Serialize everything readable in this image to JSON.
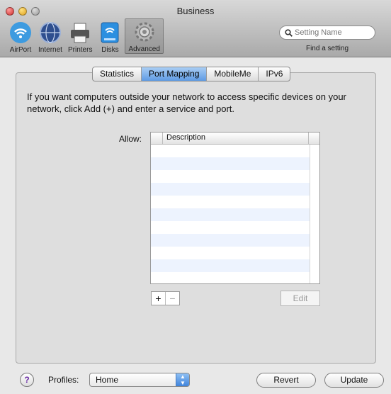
{
  "window": {
    "title": "Business"
  },
  "toolbar": {
    "items": [
      {
        "label": "AirPort",
        "icon": "airport-icon"
      },
      {
        "label": "Internet",
        "icon": "globe-icon"
      },
      {
        "label": "Printers",
        "icon": "printer-icon"
      },
      {
        "label": "Disks",
        "icon": "disk-icon"
      },
      {
        "label": "Advanced",
        "icon": "gear-icon"
      }
    ],
    "selected": "Advanced",
    "search_placeholder": "Setting Name",
    "find_label": "Find a setting"
  },
  "tabs": [
    "Statistics",
    "Port Mapping",
    "MobileMe",
    "IPv6"
  ],
  "active_tab": "Port Mapping",
  "description": "If you want computers outside your network to access specific devices on your network, click Add (+) and enter a service and port.",
  "allow": {
    "label": "Allow:",
    "column": "Description",
    "rows": []
  },
  "buttons": {
    "add": "+",
    "remove": "−",
    "edit": "Edit",
    "revert": "Revert",
    "update": "Update",
    "help": "?"
  },
  "profiles": {
    "label": "Profiles:",
    "selected": "Home"
  }
}
